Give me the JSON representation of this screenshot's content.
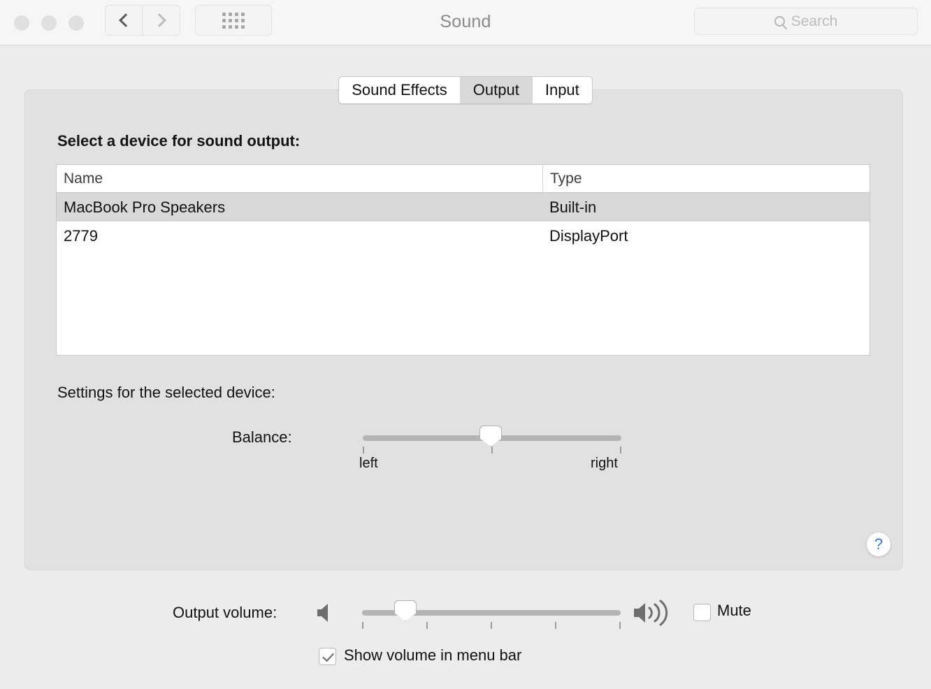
{
  "window": {
    "title": "Sound",
    "traffic_lights": [
      "close",
      "minimize",
      "zoom"
    ]
  },
  "toolbar": {
    "back_icon": "chevron-left-icon",
    "forward_icon": "chevron-right-icon",
    "grid_icon": "show-all-grid-icon",
    "search": {
      "icon": "search-icon",
      "placeholder": "Search",
      "value": ""
    }
  },
  "tabs": [
    {
      "label": "Sound Effects",
      "selected": false
    },
    {
      "label": "Output",
      "selected": true
    },
    {
      "label": "Input",
      "selected": false
    }
  ],
  "main": {
    "devices_heading": "Select a device for sound output:",
    "table": {
      "columns": [
        "Name",
        "Type"
      ],
      "rows": [
        {
          "name": "MacBook Pro Speakers",
          "type": "Built-in",
          "selected": true
        },
        {
          "name": "2779",
          "type": "DisplayPort",
          "selected": false
        }
      ]
    },
    "settings_heading": "Settings for the selected device:",
    "balance": {
      "label": "Balance:",
      "min_label": "left",
      "max_label": "right",
      "value_percent": 50,
      "tick_count": 3
    },
    "help_button": "?"
  },
  "footer": {
    "output_volume": {
      "label": "Output volume:",
      "low_icon": "speaker-low-icon",
      "high_icon": "speaker-high-icon",
      "value_percent": 16,
      "tick_count": 5
    },
    "mute": {
      "label": "Mute",
      "checked": false
    },
    "show_volume_menu_bar": {
      "label": "Show volume in menu bar",
      "checked": true
    }
  },
  "colors": {
    "window_bg": "#ececec",
    "titlebar_bg": "#f6f6f6",
    "panel_bg": "#e1e1e1",
    "row_selected": "#d8d8d8",
    "tab_selected": "#d9d9d9",
    "accent_blue": "#2a7ae4",
    "slider_track": "#b4b4b4"
  }
}
